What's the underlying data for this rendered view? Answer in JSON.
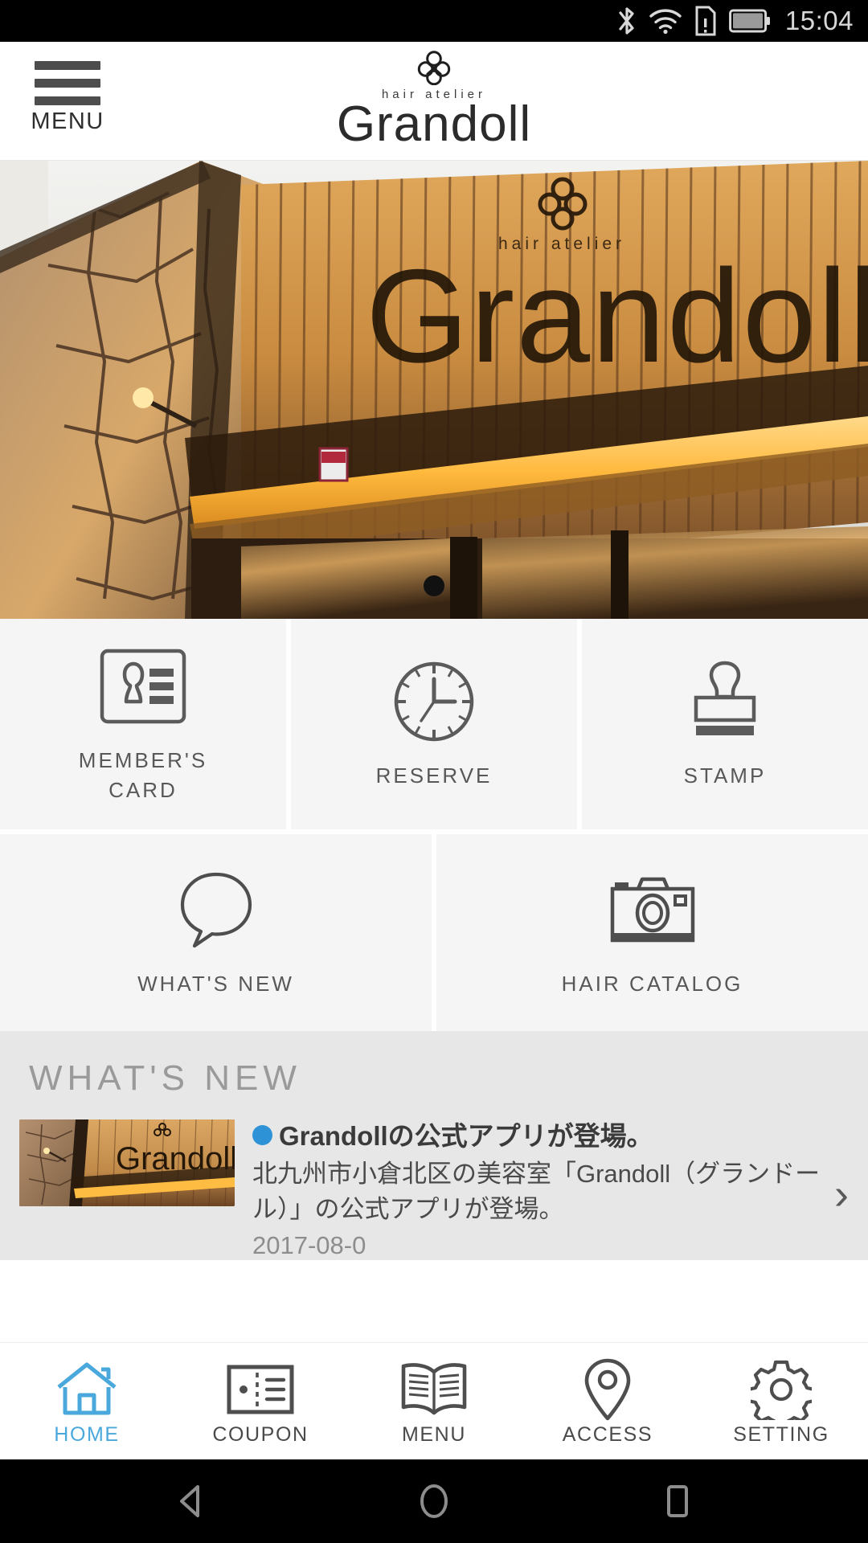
{
  "status_bar": {
    "time": "15:04",
    "icons": [
      "bluetooth-icon",
      "wifi-icon",
      "sim-card-alert-icon",
      "battery-icon"
    ]
  },
  "header": {
    "menu_label": "MENU",
    "menu_icon": "hamburger-icon",
    "brand_emblem": "clover-flower-emblem",
    "brand_tagline": "hair atelier",
    "brand_name": "Grandoll"
  },
  "hero": {
    "alt": "Grandoll salon storefront exterior at dusk with illuminated sign",
    "carousel_dots": 1,
    "active_dot": 0
  },
  "tiles": {
    "row1": [
      {
        "label": "MEMBER'S\nCARD",
        "label_line1": "MEMBER'S",
        "label_line2": "CARD",
        "icon": "member-card-icon"
      },
      {
        "label": "RESERVE",
        "label_line1": "RESERVE",
        "label_line2": "",
        "icon": "clock-icon"
      },
      {
        "label": "STAMP",
        "label_line1": "STAMP",
        "label_line2": "",
        "icon": "stamp-icon"
      }
    ],
    "row2": [
      {
        "label": "WHAT'S NEW",
        "icon": "speech-bubble-icon"
      },
      {
        "label": "HAIR CATALOG",
        "icon": "camera-icon"
      }
    ]
  },
  "whats_new": {
    "section_title": "WHAT'S NEW",
    "items": [
      {
        "bullet_color": "#2e93d6",
        "title": "Grandollの公式アプリが登場。",
        "description": "北九州市小倉北区の美容室「Grandoll（グランドール）」の公式アプリが登場。",
        "date": "2017-08-0",
        "thumb_alt": "Grandoll storefront sign",
        "chevron": "›"
      }
    ]
  },
  "bottom_nav": {
    "active_index": 0,
    "active_color": "#4ba8dd",
    "items": [
      {
        "label": "HOME",
        "icon": "house-icon"
      },
      {
        "label": "COUPON",
        "icon": "ticket-icon"
      },
      {
        "label": "MENU",
        "icon": "open-book-icon"
      },
      {
        "label": "ACCESS",
        "icon": "map-pin-icon"
      },
      {
        "label": "SETTING",
        "icon": "gear-icon"
      }
    ]
  },
  "android_nav": {
    "items": [
      {
        "name": "back-button",
        "icon": "triangle-left-icon"
      },
      {
        "name": "home-button",
        "icon": "circle-icon"
      },
      {
        "name": "recents-button",
        "icon": "square-icon"
      }
    ]
  }
}
